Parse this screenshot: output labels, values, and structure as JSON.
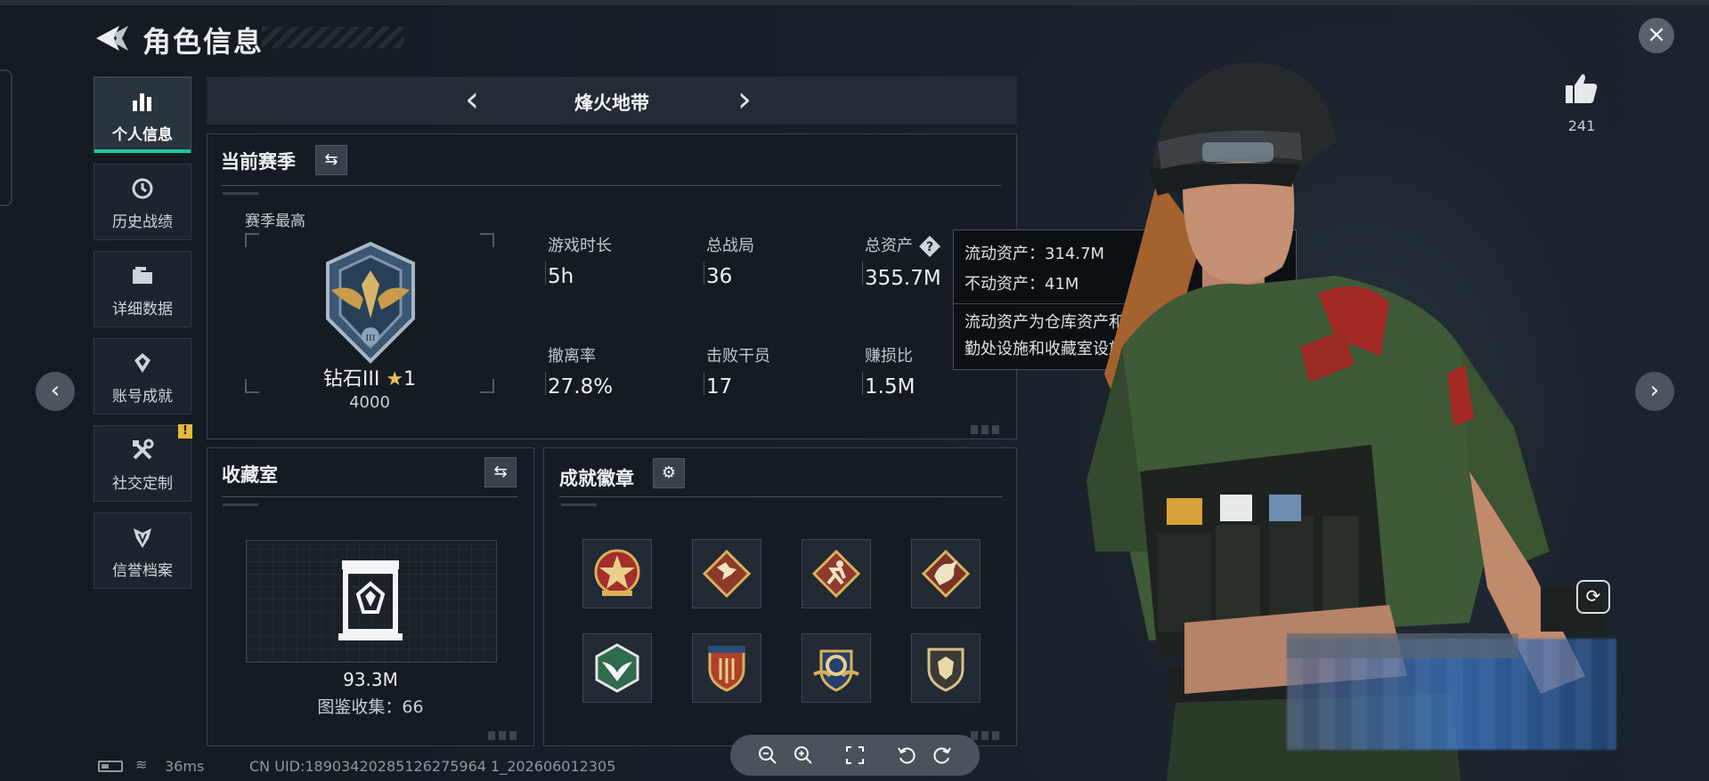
{
  "header": {
    "title": "角色信息",
    "close_label": "×"
  },
  "nav": [
    {
      "label": "个人信息",
      "icon": "bar-chart-icon",
      "active": true
    },
    {
      "label": "历史战绩",
      "icon": "history-icon",
      "active": false
    },
    {
      "label": "详细数据",
      "icon": "folder-icon",
      "active": false
    },
    {
      "label": "账号成就",
      "icon": "achievement-icon",
      "active": false
    },
    {
      "label": "社交定制",
      "icon": "tools-icon",
      "active": false,
      "badge": "!"
    },
    {
      "label": "信誉档案",
      "icon": "credit-icon",
      "active": false
    }
  ],
  "mode": {
    "title": "烽火地带",
    "prev": "‹",
    "next": "›"
  },
  "season": {
    "title": "当前赛季",
    "subtitle": "赛季最高",
    "rank_name": "钻石III",
    "rank_stars": "1",
    "rank_score": "4000",
    "stats": [
      {
        "label": "游戏时长",
        "value": "5h"
      },
      {
        "label": "总战局",
        "value": "36"
      },
      {
        "label": "总资产",
        "value": "355.7M"
      },
      {
        "label": "撤离率",
        "value": "27.8%"
      },
      {
        "label": "击败干员",
        "value": "17"
      },
      {
        "label": "赚损比",
        "value": "1.5M"
      }
    ]
  },
  "tooltip": {
    "liquid": "流动资产：314.7M",
    "fixed": "不动资产：41M",
    "note": "流动资产为仓库资产和哈夫币，不动资产为特勤处设施和收藏室设施"
  },
  "collection": {
    "title": "收藏室",
    "value": "93.3M",
    "count": "图鉴收集：66"
  },
  "badges": {
    "title": "成就徽章",
    "items": [
      "star-emblem-badge",
      "wolf-badge",
      "runner-badge",
      "dragon-badge",
      "eagle-hex-badge",
      "shield-stripe-badge",
      "gear-wings-badge",
      "shield-lion-badge"
    ]
  },
  "likes": {
    "count": "241"
  },
  "status": {
    "ping": "36ms",
    "uid": "CN UID:18903420285126275964 1_202606012305"
  },
  "colors": {
    "accent": "#1ecb97",
    "star": "#e6c15a",
    "alert": "#e8b93c"
  }
}
